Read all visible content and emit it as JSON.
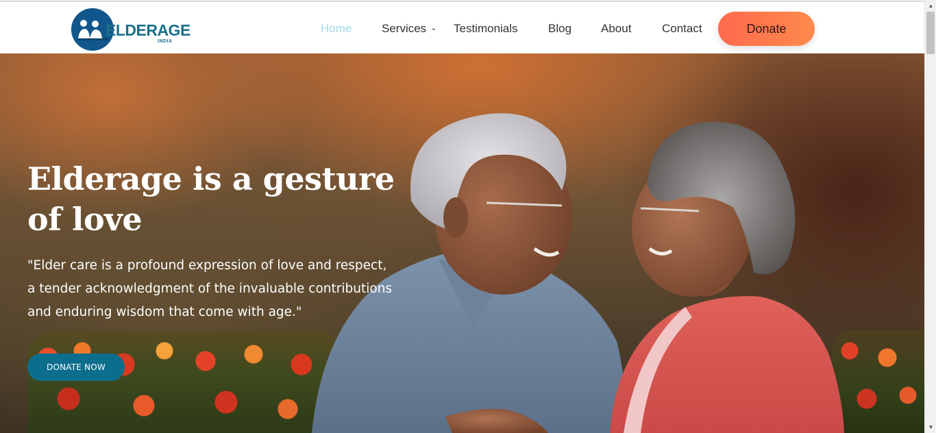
{
  "brand": {
    "name": "ELDERAGE",
    "sub": "INDIA",
    "color": "#1b6f8a"
  },
  "nav": {
    "items": [
      {
        "label": "Home",
        "active": true
      },
      {
        "label": "Services",
        "has_dropdown": true
      },
      {
        "label": "Testimonials"
      },
      {
        "label": "Blog"
      },
      {
        "label": "About"
      },
      {
        "label": "Contact"
      }
    ],
    "donate_label": "Donate",
    "active_color": "#9fdbe8",
    "donate_color": "#ff7a4c"
  },
  "hero": {
    "title_line1": "Elderage is a gesture",
    "title_line2": "of love",
    "quote_line1": "\"Elder care is a profound expression of love and respect,",
    "quote_line2": "a tender acknowledgment of the invaluable contributions",
    "quote_line3": "and enduring wisdom that come with age.\"",
    "cta_label": "DONATE NOW",
    "cta_color": "#0c6e8d"
  },
  "icons": {
    "dropdown": "chevron-down-icon",
    "scroll_up": "arrow-up-icon",
    "scroll_down": "arrow-down-icon"
  }
}
